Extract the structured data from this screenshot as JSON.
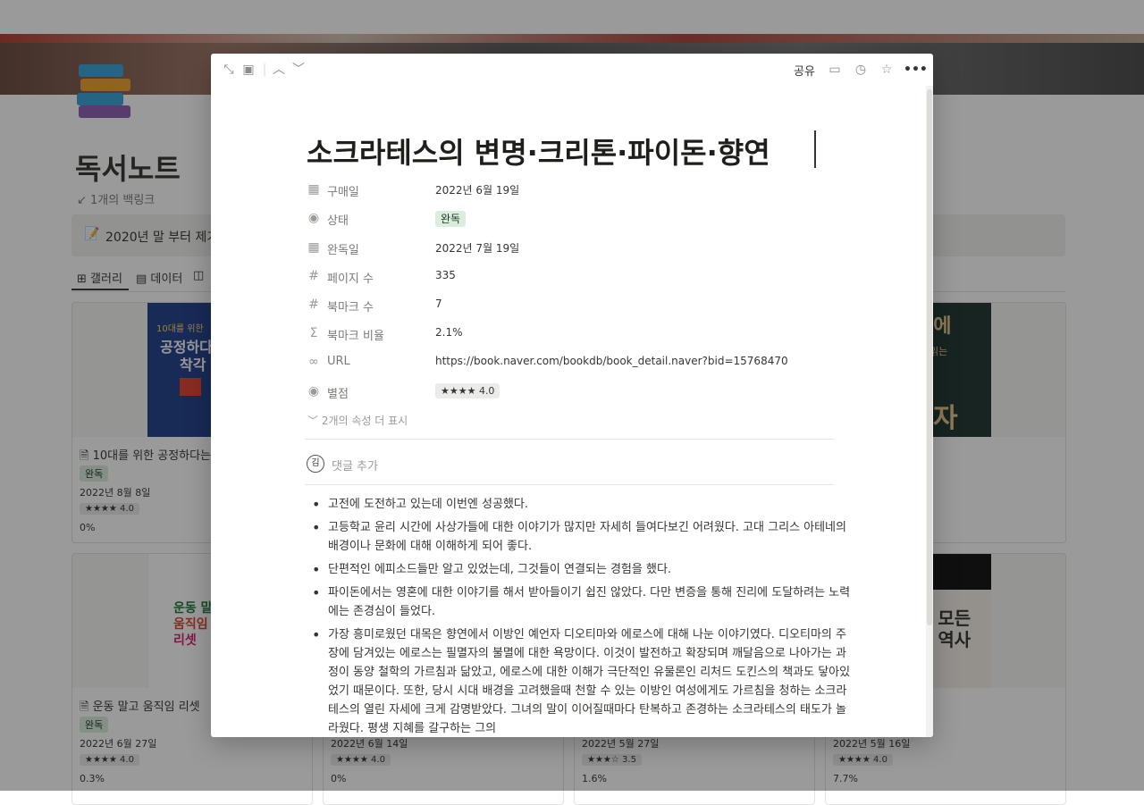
{
  "background": {
    "title": "독서노트",
    "backlinks": "1개의 백링크",
    "callout": "2020년 말 부터 제기",
    "views": [
      {
        "label": "갤러리"
      },
      {
        "label": "데이터"
      }
    ],
    "cards": [
      {
        "title": "10대를 위한 공정하다는 착",
        "status": "완독",
        "date": "2022년 8월 8일",
        "rating": "★★★★ 4.0",
        "pct": "0%"
      },
      {
        "title": "운동 말고 움직임 리셋",
        "status": "완독",
        "date": "2022년 6월 27일",
        "rating": "★★★★ 4.0",
        "pct": "0.3%"
      },
      {
        "title": "",
        "status": "",
        "date": "2022년 6월 14일",
        "rating": "★★★★ 4.0",
        "pct": "0%"
      },
      {
        "title": "",
        "status": "",
        "date": "2022년 5월 27일",
        "rating": "★★★☆ 3.5",
        "pct": "1.6%"
      },
      {
        "title": "",
        "status": "",
        "date": "2022년 5월 16일",
        "rating": "★★★★ 4.0",
        "pct": "7.7%"
      }
    ],
    "cover_texts": {
      "book1_line1": "10대를 위한",
      "book1_line2": "공정하다",
      "book1_line3": "착각",
      "book2_line1": "운동 말",
      "book2_line2": "움직임",
      "book2_line3": "리셋",
      "book3_line1": "십에",
      "book3_line2": "읽는",
      "book3_line3": "자",
      "book4_line1": "의 모든",
      "book4_line2": "지 역사"
    }
  },
  "modal": {
    "toolbar": {
      "share": "공유"
    },
    "title": "소크라테스의 변명·크리톤·파이돈·향연",
    "properties": [
      {
        "icon": "calendar-icon",
        "name": "구매일",
        "value": "2022년 6월 19일"
      },
      {
        "icon": "select-icon",
        "name": "상태",
        "value": "완독"
      },
      {
        "icon": "calendar-icon",
        "name": "완독일",
        "value": "2022년 7월 19일"
      },
      {
        "icon": "number-icon",
        "name": "페이지 수",
        "value": "335"
      },
      {
        "icon": "number-icon",
        "name": "북마크 수",
        "value": "7"
      },
      {
        "icon": "formula-icon",
        "name": "북마크 비율",
        "value": "2.1%"
      },
      {
        "icon": "link-icon",
        "name": "URL",
        "value": "https://book.naver.com/bookdb/book_detail.naver?bid=15768470"
      },
      {
        "icon": "select-icon",
        "name": "별점",
        "value": "★★★★ 4.0"
      }
    ],
    "more_properties": "2개의 속성 더 표시",
    "comment_avatar": "김",
    "comment_placeholder": "댓글 추가",
    "bullets": [
      "고전에 도전하고 있는데 이번엔 성공했다.",
      "고등학교 윤리 시간에 사상가들에 대한 이야기가 많지만 자세히 들여다보긴 어려웠다. 고대 그리스 아테네의 배경이나 문화에 대해 이해하게 되어 좋다.",
      "단편적인 에피소드들만 알고 있었는데, 그것들이 연결되는 경험을 했다.",
      "파이돈에서는 영혼에 대한 이야기를 해서 받아들이기 쉽진 않았다. 다만 변증을 통해 진리에 도달하려는 노력에는 존경심이 들었다.",
      "가장 흥미로웠던 대목은 향연에서 이방인 예언자 디오티마와 에로스에 대해 나눈 이야기였다. 디오티마의 주장에 담겨있는 에로스는 필멸자의 불멸에 대한 욕망이다. 이것이 발전하고 확장되며 깨달음으로 나아가는 과정이 동양 철학의 가르침과 닮았고, 에로스에 대한 이해가 극단적인 유물론인 리처드 도킨스의 책과도 닿아있었기 때문이다. 또한, 당시 시대 배경을 고려했을때 천할 수 있는 이방인 여성에게도 가르침을 청하는 소크라테스의 열린 자세에 크게 감명받았다. 그녀의 말이 이어질때마다 탄복하고 존경하는 소크라테스의 태도가 놀라웠다. 평생 지혜를 갈구하는 그의"
    ]
  }
}
